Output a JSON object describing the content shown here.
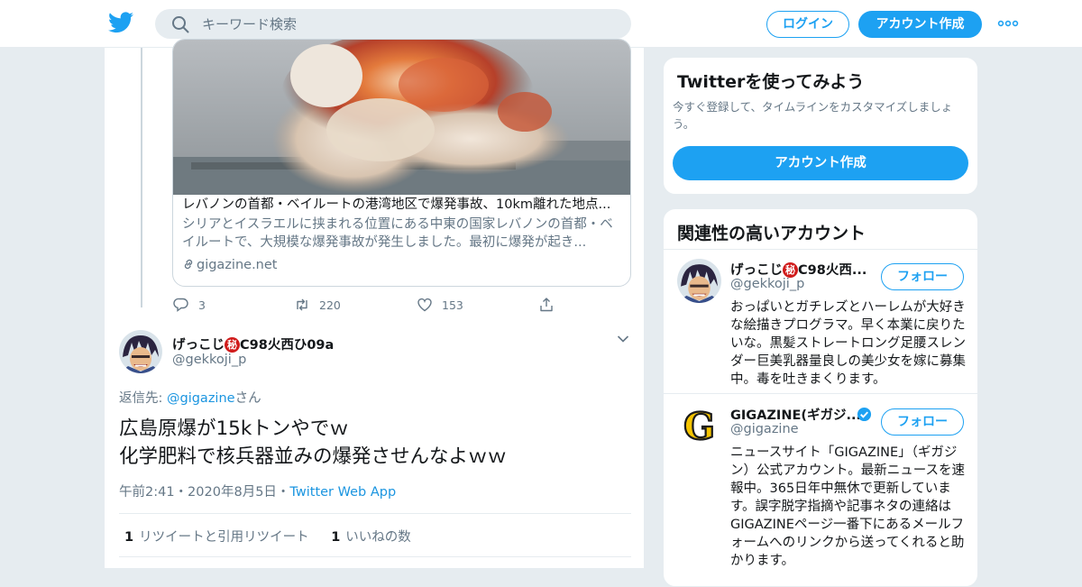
{
  "header": {
    "search_placeholder": "キーワード検索",
    "login_label": "ログイン",
    "signup_label": "アカウント作成",
    "colors": {
      "brand": "#1da1f2",
      "link": "#1b95e0"
    }
  },
  "card": {
    "title": "レバノンの首都・ベイルートの港湾地区で爆発事故、10km離れた地点...",
    "description": "シリアとイスラエルに挟まれる位置にある中東の国家レバノンの首都・ベイルートで、大規模な爆発事故が発生しました。最初に爆発が起き...",
    "domain": "gigazine.net"
  },
  "actions": {
    "replies": "3",
    "retweets": "220",
    "likes": "153"
  },
  "tweet": {
    "name": "げっこじ",
    "secret_mark": "秘",
    "name_suffix": "C98火西ひ09a",
    "handle": "@gekkoji_p",
    "reply_prefix": "返信先: ",
    "reply_mention": "@gigazine",
    "reply_suffix": "さん",
    "text_line1": "広島原爆が15kトンやでｗ",
    "text_line2": "化学肥料で核兵器並みの爆発させんなよｗｗ",
    "time": "午前2:41・2020年8月5日・",
    "source": "Twitter Web App",
    "retweet_count": "1",
    "retweet_label": "リツイートと引用リツイート",
    "like_count": "1",
    "like_label": "いいねの数"
  },
  "sidebar": {
    "try_title": "Twitterを使ってみよう",
    "try_desc": "今すぐ登録して、タイムラインをカスタマイズしましょう。",
    "try_button": "アカウント作成",
    "related_title": "関連性の高いアカウント",
    "accounts": [
      {
        "name": "げっこじ",
        "secret_mark": "秘",
        "name_suffix": "C98火西...",
        "handle": "@gekkoji_p",
        "follow_label": "フォロー",
        "bio": "おっぱいとガチレズとハーレムが大好きな絵描きプログラマ。早く本業に戻りたいな。黒髪ストレートロング足腰スレンダー巨美乳器量良しの美少女を嫁に募集中。毒を吐きまくります。"
      },
      {
        "name": "GIGAZINE(ギガジ...",
        "handle": "@gigazine",
        "follow_label": "フォロー",
        "avatar_letter": "G",
        "bio": "ニュースサイト「GIGAZINE」（ギガジン）公式アカウント。最新ニュースを速報中。365日年中無休で更新しています。誤字脱字指摘や記事ネタの連絡はGIGAZINEページ一番下にあるメールフォームへのリンクから送ってくれると助かります。"
      }
    ]
  }
}
